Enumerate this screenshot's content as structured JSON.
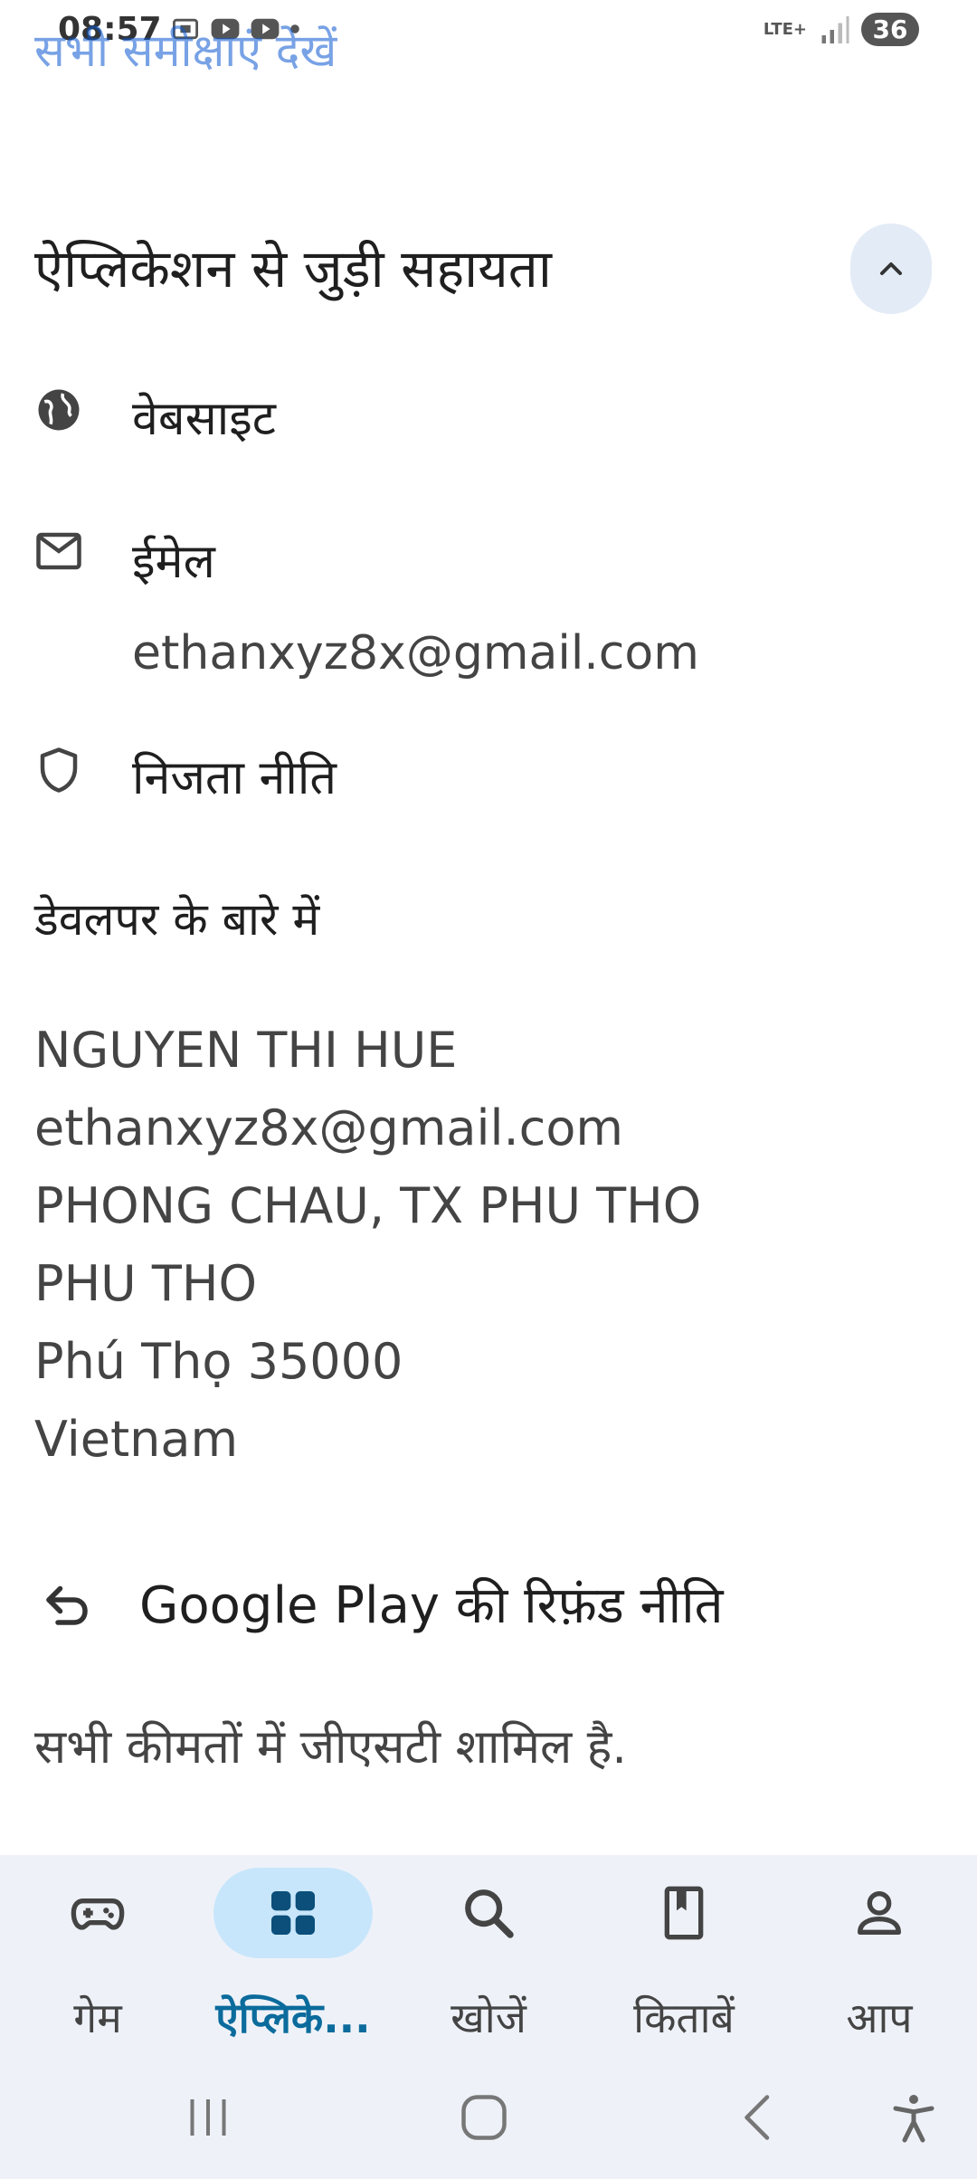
{
  "status_bar": {
    "time": "08:57",
    "network": "LTE+",
    "battery": "36"
  },
  "top_link": "सभी समीक्षाएं देखें",
  "support": {
    "title": "ऐप्लिकेशन से जुड़ी सहायता",
    "website_label": "वेबसाइट",
    "email_label": "ईमेल",
    "email_value": "ethanxyz8x@gmail.com",
    "privacy_label": "निजता नीति"
  },
  "developer": {
    "heading": "डेवलपर के बारे में",
    "lines": [
      "NGUYEN THI HUE",
      "ethanxyz8x@gmail.com",
      "PHONG CHAU, TX PHU THO",
      "PHU THO",
      "Phú Thọ 35000",
      "Vietnam"
    ]
  },
  "refund_policy": "Google Play की रिफ़ंड नीति",
  "gst_note": "सभी कीमतों में जीएसटी शामिल है.",
  "bottom_nav": {
    "items": [
      {
        "label": "गेम",
        "icon": "gamepad-icon",
        "active": false
      },
      {
        "label": "ऐप्लिके...",
        "icon": "apps-icon",
        "active": true
      },
      {
        "label": "खोजें",
        "icon": "search-icon",
        "active": false
      },
      {
        "label": "किताबें",
        "icon": "book-icon",
        "active": false
      },
      {
        "label": "आप",
        "icon": "person-icon",
        "active": false
      }
    ]
  },
  "colors": {
    "accent": "#0b57d0",
    "nav_active_pill": "#c8e6fb",
    "nav_active_label": "#0b6b9c",
    "nav_background": "#eef2f8"
  }
}
